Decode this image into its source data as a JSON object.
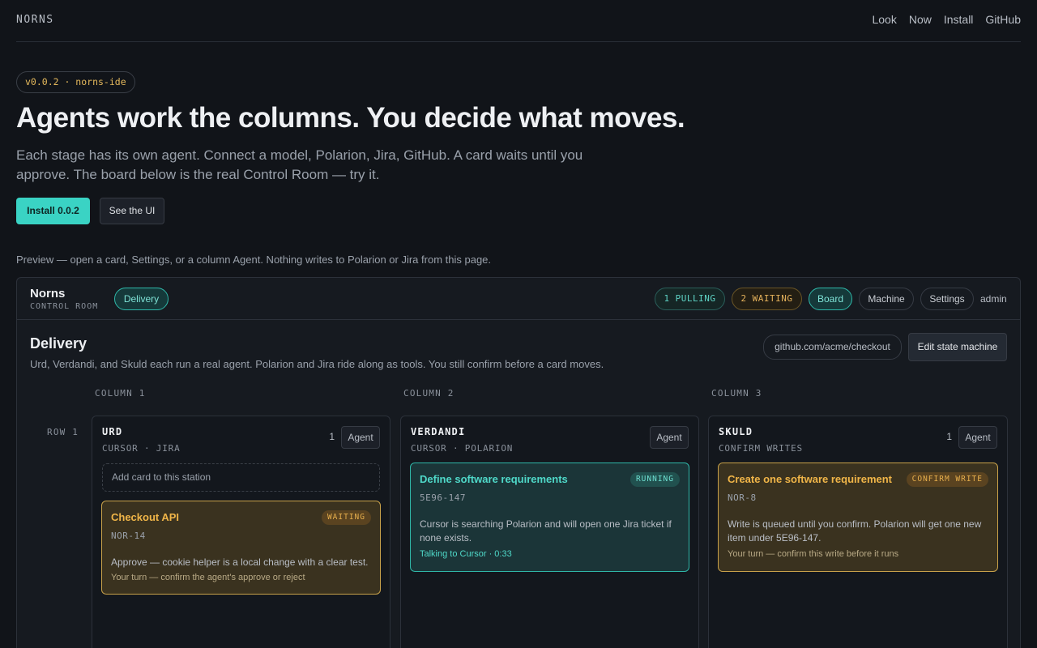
{
  "nav": {
    "brand": "NORNS",
    "links": [
      "Look",
      "Now",
      "Install",
      "GitHub"
    ]
  },
  "hero": {
    "version": "v0.0.2 · norns-ide",
    "title": "Agents work the columns. You decide what moves.",
    "subtitle": "Each stage has its own agent. Connect a model, Polarion, Jira, GitHub. A card waits until you approve. The board below is the real Control Room — try it.",
    "install_label": "Install 0.0.2",
    "see_ui_label": "See the UI",
    "preview_note": "Preview — open a card, Settings, or a column Agent. Nothing writes to Polarion or Jira from this page."
  },
  "app": {
    "name": "Norns",
    "subtitle": "CONTROL ROOM",
    "workspace_pill": "Delivery",
    "pulling": "1 PULLING",
    "waiting": "2 WAITING",
    "tabs": [
      "Board",
      "Machine",
      "Settings"
    ],
    "user": "admin",
    "page_title": "Delivery",
    "page_desc": "Urd, Verdandi, and Skuld each run a real agent. Polarion and Jira ride along as tools. You still confirm before a card moves.",
    "repo": "github.com/acme/checkout",
    "edit_label": "Edit state machine",
    "columns": [
      "COLUMN 1",
      "COLUMN 2",
      "COLUMN 3"
    ],
    "row_label": "ROW 1",
    "agent_label": "Agent",
    "stations": [
      {
        "name": "URD",
        "tools": "CURSOR · JIRA",
        "count": "1",
        "add_card": "Add card to this station",
        "card": {
          "title": "Checkout API",
          "badge": "WAITING",
          "id": "NOR-14",
          "body": "Approve — cookie helper is a local change with a clear test.",
          "footer": "Your turn — confirm the agent's approve or reject"
        }
      },
      {
        "name": "VERDANDI",
        "tools": "CURSOR · POLARION",
        "card": {
          "title": "Define software requirements",
          "badge": "RUNNING",
          "id": "5E96-147",
          "body": "Cursor is searching Polarion and will open one Jira ticket if none exists.",
          "footer": "Talking to Cursor · 0:33"
        }
      },
      {
        "name": "SKULD",
        "tools": "CONFIRM WRITES",
        "count": "1",
        "card": {
          "title": "Create one software requirement",
          "badge": "CONFIRM WRITE",
          "id": "NOR-8",
          "body": "Write is queued until you confirm. Polarion will get one new item under 5E96-147.",
          "footer": "Your turn — confirm this write before it runs"
        }
      }
    ]
  }
}
